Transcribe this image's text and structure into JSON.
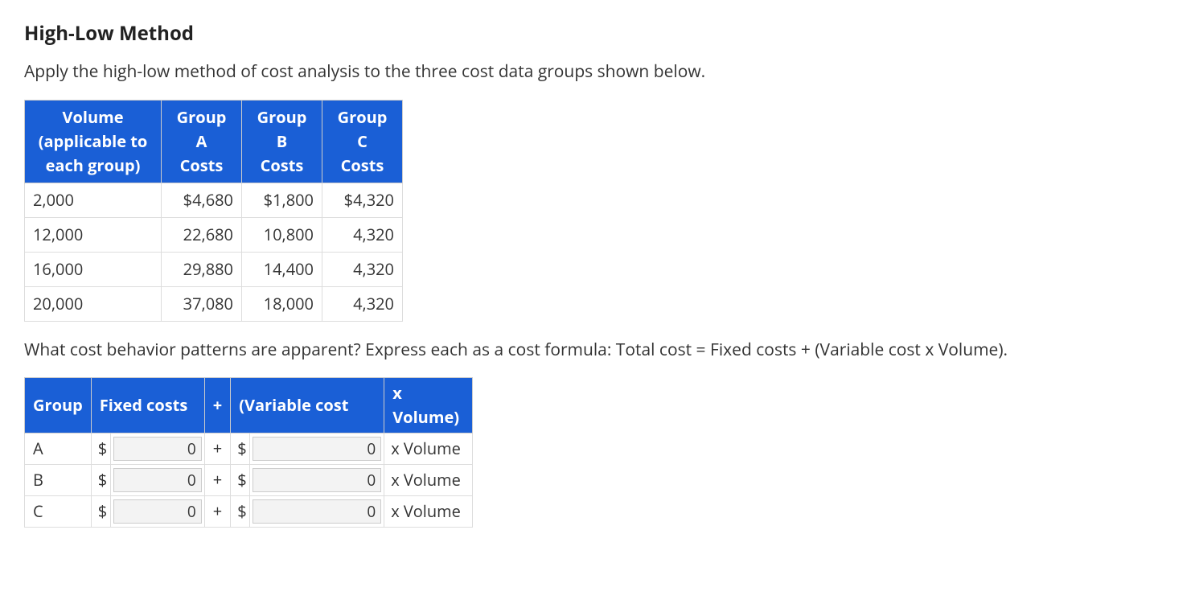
{
  "heading": "High-Low Method",
  "intro": "Apply the high-low method of cost analysis to the three cost data groups shown below.",
  "data_table": {
    "headers": {
      "volume_line1": "Volume",
      "volume_line2": "(applicable to",
      "volume_line3": "each group)",
      "groupA_line1": "Group A",
      "groupA_line2": "Costs",
      "groupB_line1": "Group B",
      "groupB_line2": "Costs",
      "groupC_line1": "Group C",
      "groupC_line2": "Costs"
    },
    "rows": [
      {
        "volume": "2,000",
        "a": "$4,680",
        "b": "$1,800",
        "c": "$4,320"
      },
      {
        "volume": "12,000",
        "a": "22,680",
        "b": "10,800",
        "c": "4,320"
      },
      {
        "volume": "16,000",
        "a": "29,880",
        "b": "14,400",
        "c": "4,320"
      },
      {
        "volume": "20,000",
        "a": "37,080",
        "b": "18,000",
        "c": "4,320"
      }
    ]
  },
  "question": "What cost behavior patterns are apparent? Express each as a cost formula: Total cost = Fixed costs + (Variable cost x Volume).",
  "formula_table": {
    "headers": {
      "group": "Group",
      "fixed": "Fixed costs",
      "plus": "+",
      "variable": "(Variable cost",
      "xvol": "x Volume)"
    },
    "rows": [
      {
        "group": "A",
        "dollar1": "$",
        "fixed_val": "0",
        "plus": "+",
        "dollar2": "$",
        "var_val": "0",
        "xvol": "x Volume"
      },
      {
        "group": "B",
        "dollar1": "$",
        "fixed_val": "0",
        "plus": "+",
        "dollar2": "$",
        "var_val": "0",
        "xvol": "x Volume"
      },
      {
        "group": "C",
        "dollar1": "$",
        "fixed_val": "0",
        "plus": "+",
        "dollar2": "$",
        "var_val": "0",
        "xvol": "x Volume"
      }
    ]
  }
}
